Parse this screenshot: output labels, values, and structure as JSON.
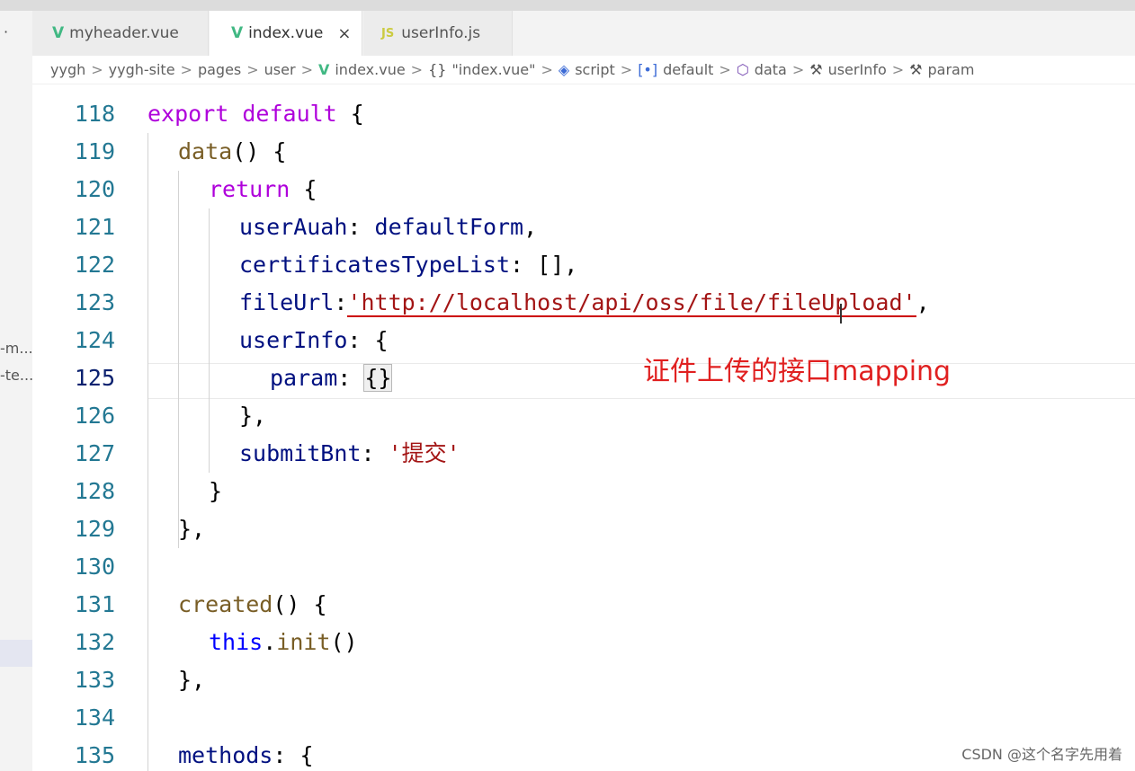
{
  "sidebar": {
    "menu_glyph": "·",
    "items": [
      "-m...",
      "-te..."
    ]
  },
  "tabs": [
    {
      "label": "myheader.vue",
      "icon": "vue-icon"
    },
    {
      "label": "index.vue",
      "icon": "vue-icon",
      "active": true,
      "close": "×"
    },
    {
      "label": "userInfo.js",
      "icon": "js-icon",
      "icon_text": "JS"
    }
  ],
  "breadcrumb": {
    "items": [
      "yygh",
      "yygh-site",
      "pages",
      "user",
      "index.vue",
      "\"index.vue\"",
      "script",
      "default",
      "data",
      "userInfo",
      "param"
    ],
    "separator": ">"
  },
  "editor": {
    "lines": [
      {
        "num": "118"
      },
      {
        "num": "119"
      },
      {
        "num": "120"
      },
      {
        "num": "121"
      },
      {
        "num": "122"
      },
      {
        "num": "123"
      },
      {
        "num": "124"
      },
      {
        "num": "125"
      },
      {
        "num": "126"
      },
      {
        "num": "127"
      },
      {
        "num": "128"
      },
      {
        "num": "129"
      },
      {
        "num": "130"
      },
      {
        "num": "131"
      },
      {
        "num": "132"
      },
      {
        "num": "133"
      },
      {
        "num": "134"
      },
      {
        "num": "135"
      }
    ],
    "tokens": {
      "export": "export",
      "default": "default",
      "open_brace": "{",
      "data_fn": "data",
      "parens": "()",
      "return_kw": "return",
      "userAuah": "userAuah",
      "defaultForm": "defaultForm",
      "certificatesTypeList": "certificatesTypeList",
      "empty_array": "[]",
      "fileUrl": "fileUrl",
      "file_url_value": "'http://localhost/api/oss/file/fileUpload'",
      "userInfo": "userInfo",
      "param": "param",
      "empty_obj": "{}",
      "submitBnt": "submitBnt",
      "submit_value": "'提交'",
      "created_fn": "created",
      "this_kw": "this",
      "init_fn": "init",
      "methods": "methods"
    }
  },
  "annotation": "证件上传的接口mapping",
  "watermark": "CSDN @这个名字先用着",
  "colors": {
    "line_number": "#237893",
    "keyword": "#af00db",
    "function": "#795e26",
    "property": "#001080",
    "string": "#a31515",
    "annotation": "#e02020",
    "vue_green": "#41b883"
  }
}
